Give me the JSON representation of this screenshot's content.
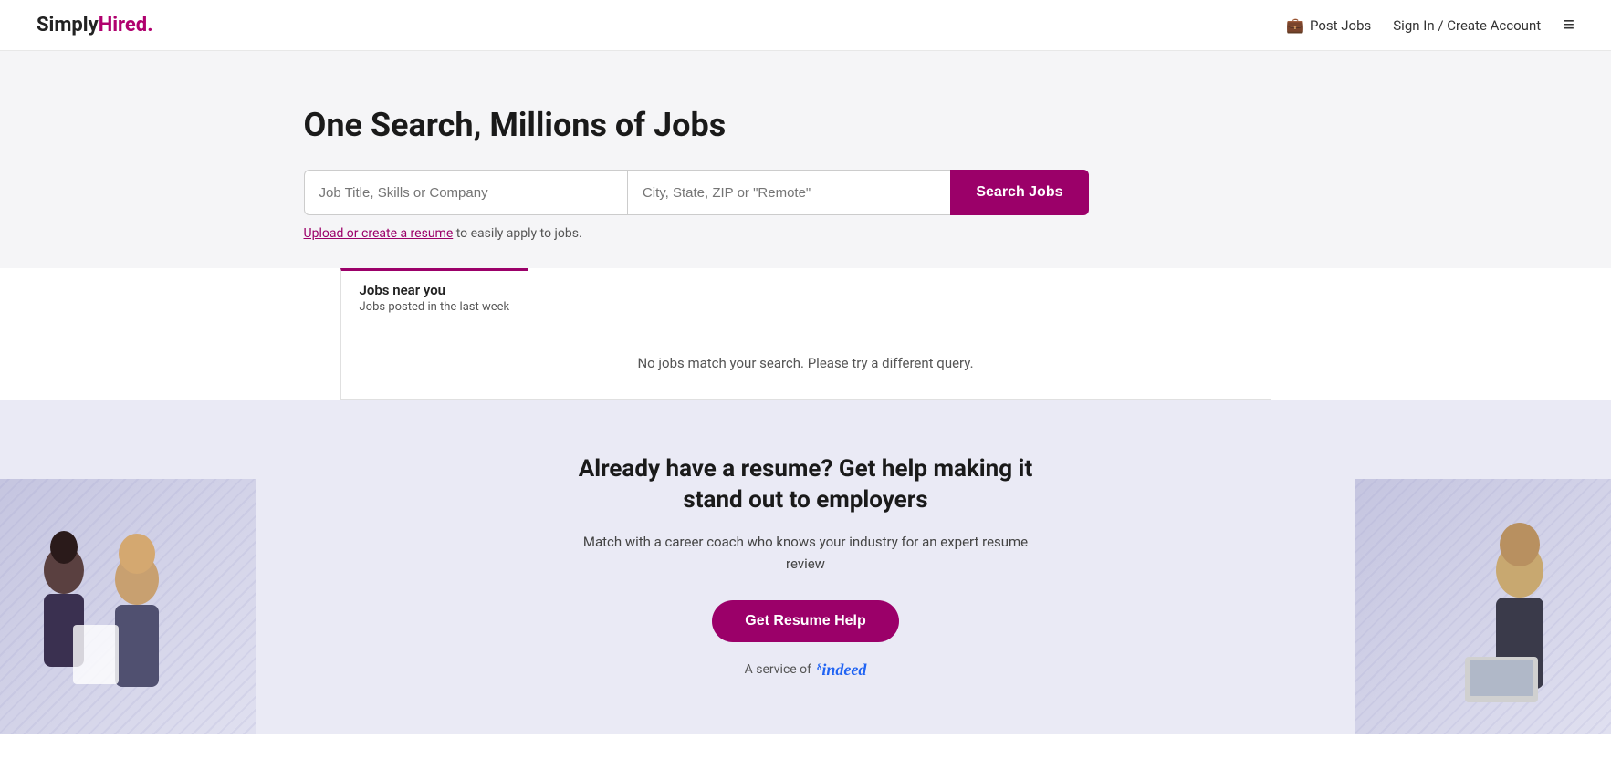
{
  "header": {
    "logo_simply": "Simply",
    "logo_hired": "Hired",
    "logo_dot": ".",
    "post_jobs_label": "Post Jobs",
    "sign_in_label": "Sign In / Create Account",
    "menu_icon": "≡"
  },
  "hero": {
    "title": "One Search, Millions of Jobs",
    "job_input_placeholder": "Job Title, Skills or Company",
    "location_input_placeholder": "City, State, ZIP or \"Remote\"",
    "search_button_label": "Search Jobs",
    "upload_text_prefix": "to easily apply to jobs.",
    "upload_link_text": "Upload or create a resume"
  },
  "tabs": [
    {
      "title": "Jobs near you",
      "subtitle": "Jobs posted in the last week",
      "active": true
    }
  ],
  "results": {
    "no_results_message": "No jobs match your search. Please try a different query."
  },
  "resume_section": {
    "title": "Already have a resume? Get help making it stand out to employers",
    "description": "Match with a career coach who knows your industry for an expert resume review",
    "button_label": "Get Resume Help",
    "service_prefix": "A service of",
    "indeed_label": "indeed"
  }
}
